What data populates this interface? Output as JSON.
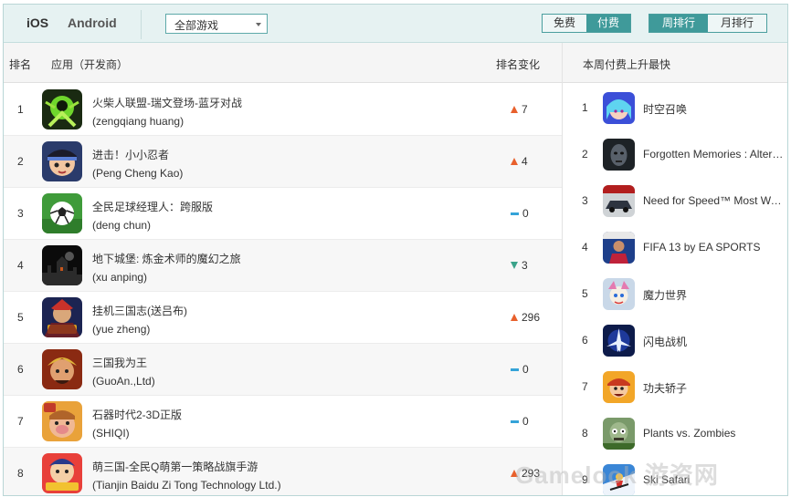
{
  "topbar": {
    "platforms": [
      "iOS",
      "Android"
    ],
    "game_filter": "全部游戏",
    "price_tabs": [
      "免费",
      "付费"
    ],
    "period_tabs": [
      "周排行",
      "月排行"
    ]
  },
  "table": {
    "headers": {
      "rank": "排名",
      "app": "应用（开发商）",
      "change": "排名变化"
    },
    "rows": [
      {
        "rank": "1",
        "name": "火柴人联盟-瑞文登场-蓝牙对战",
        "developer": "(zengqiang huang)",
        "trend": "up",
        "change": "7"
      },
      {
        "rank": "2",
        "name": "进击！小小忍者",
        "developer": "(Peng Cheng Kao)",
        "trend": "up",
        "change": "4"
      },
      {
        "rank": "3",
        "name": "全民足球经理人：跨服版",
        "developer": "(deng chun)",
        "trend": "flat",
        "change": "0"
      },
      {
        "rank": "4",
        "name": "地下城堡: 炼金术师的魔幻之旅",
        "developer": "(xu anping)",
        "trend": "down",
        "change": "3"
      },
      {
        "rank": "5",
        "name": "挂机三国志(送吕布)",
        "developer": "(yue zheng)",
        "trend": "up",
        "change": "296"
      },
      {
        "rank": "6",
        "name": "三国我为王",
        "developer": "(GuoAn.,Ltd)",
        "trend": "flat",
        "change": "0"
      },
      {
        "rank": "7",
        "name": "石器时代2-3D正版",
        "developer": "(SHIQI)",
        "trend": "flat",
        "change": "0"
      },
      {
        "rank": "8",
        "name": "萌三国-全民Q萌第一策略战旗手游",
        "developer": "(Tianjin Baidu Zi Tong Technology Ltd.)",
        "trend": "up",
        "change": "293"
      }
    ]
  },
  "sidebar": {
    "title": "本周付费上升最快",
    "items": [
      {
        "rank": "1",
        "name": "时空召唤"
      },
      {
        "rank": "2",
        "name": "Forgotten Memories : Alternate Realities"
      },
      {
        "rank": "3",
        "name": "Need for Speed™ Most Wanted"
      },
      {
        "rank": "4",
        "name": "FIFA 13 by EA SPORTS"
      },
      {
        "rank": "5",
        "name": "魔力世界"
      },
      {
        "rank": "6",
        "name": "闪电战机"
      },
      {
        "rank": "7",
        "name": "功夫轿子"
      },
      {
        "rank": "8",
        "name": "Plants vs. Zombies"
      },
      {
        "rank": "9",
        "name": "Ski Safari"
      }
    ]
  },
  "watermark": "Gamelook 游资网",
  "colors": {
    "accent": "#3f9a9a",
    "up": "#e8602c",
    "down": "#3aa38a",
    "flat": "#35a3d8"
  }
}
